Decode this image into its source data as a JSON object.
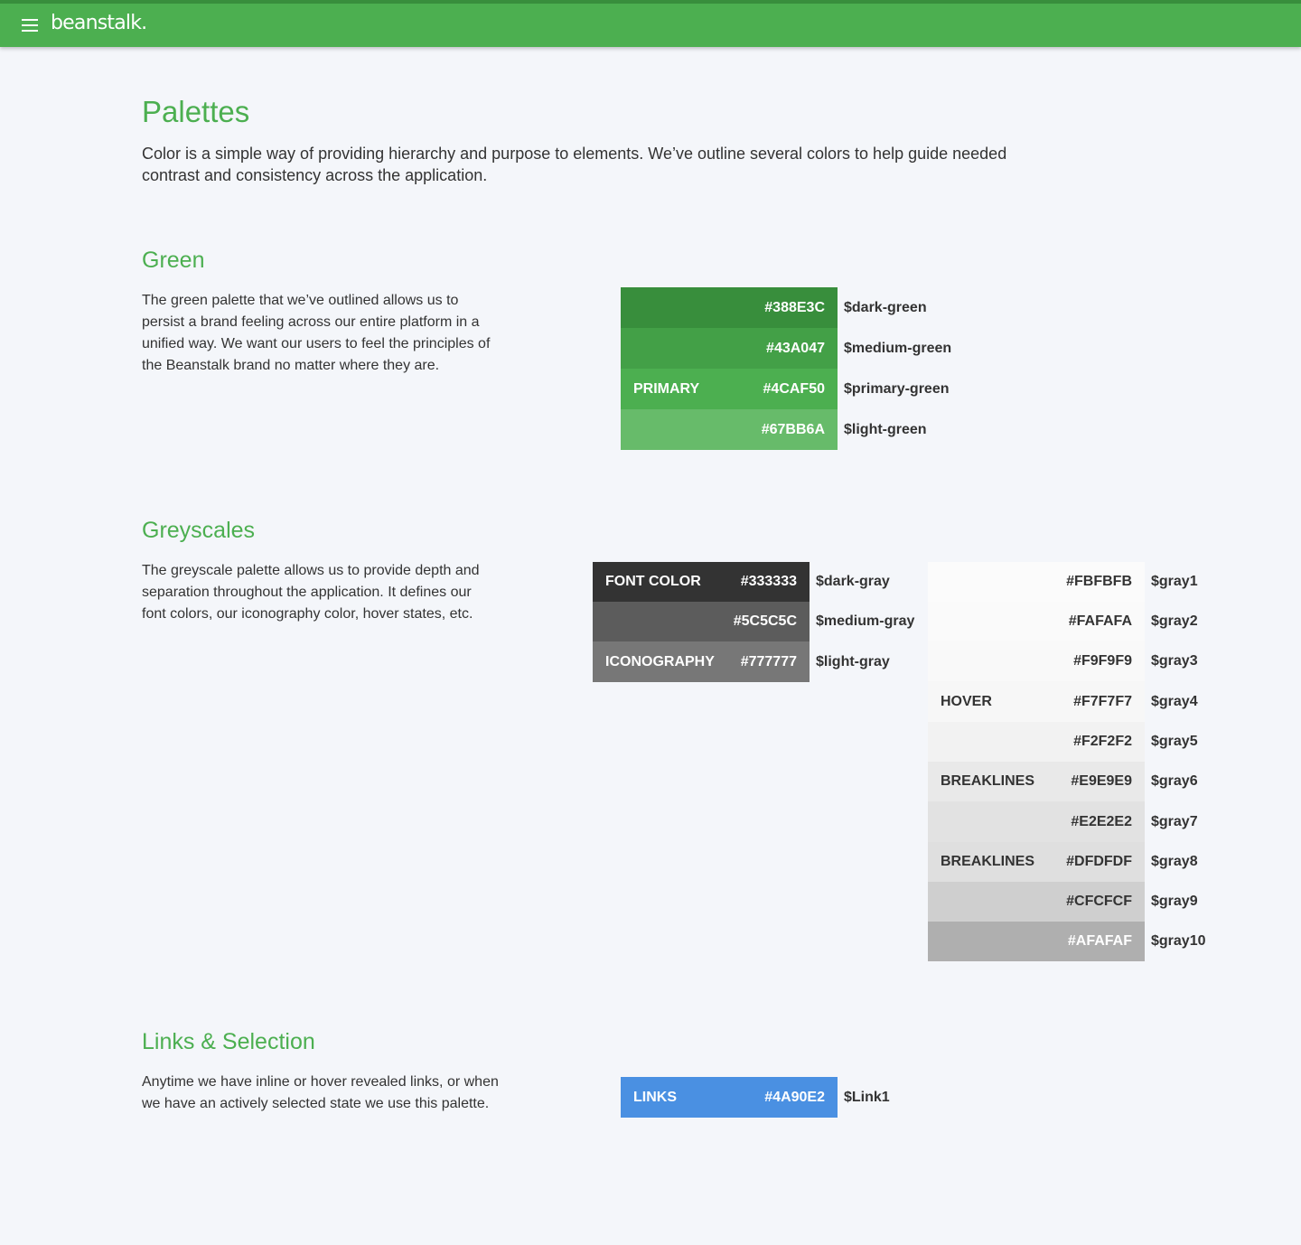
{
  "header": {
    "logo": "beanstalk."
  },
  "page": {
    "title": "Palettes",
    "intro": "Color is a simple way of providing hierarchy and purpose to elements. We’ve outline several colors to help guide needed contrast and  consistency across the application."
  },
  "green": {
    "title": "Green",
    "description": "The green palette that we’ve outlined allows us to persist a brand feeling across our entire platform in a unified way. We want our users to feel the principles of the Beanstalk brand no matter where they are.",
    "swatches": [
      {
        "label": "",
        "hex": "#388E3C",
        "var": "$dark-green",
        "color": "#388e3c"
      },
      {
        "label": "",
        "hex": "#43A047",
        "var": "$medium-green",
        "color": "#43a047"
      },
      {
        "label": "PRIMARY",
        "hex": "#4CAF50",
        "var": "$primary-green",
        "color": "#4caf50"
      },
      {
        "label": "",
        "hex": "#67BB6A",
        "var": "$light-green",
        "color": "#67bb6a"
      }
    ]
  },
  "greyscales": {
    "title": "Greyscales",
    "description": "The greyscale palette allows us to provide depth and separation throughout the application. It defines our font colors, our iconography color, hover states, etc.",
    "dark_swatches": [
      {
        "label": "FONT COLOR",
        "hex": "#333333",
        "var": "$dark-gray",
        "color": "#333333"
      },
      {
        "label": "",
        "hex": "#5C5C5C",
        "var": "$medium-gray",
        "color": "#5c5c5c"
      },
      {
        "label": "ICONOGRAPHY",
        "hex": "#777777",
        "var": "$light-gray",
        "color": "#777777"
      }
    ],
    "light_swatches": [
      {
        "label": "",
        "hex": "#FBFBFB",
        "var": "$gray1",
        "color": "#fbfbfb"
      },
      {
        "label": "",
        "hex": "#FAFAFA",
        "var": "$gray2",
        "color": "#fafafa"
      },
      {
        "label": "",
        "hex": "#F9F9F9",
        "var": "$gray3",
        "color": "#f9f9f9"
      },
      {
        "label": "HOVER",
        "hex": "#F7F7F7",
        "var": "$gray4",
        "color": "#f7f7f7"
      },
      {
        "label": "",
        "hex": "#F2F2F2",
        "var": "$gray5",
        "color": "#f2f2f2"
      },
      {
        "label": "BREAKLINES",
        "hex": "#E9E9E9",
        "var": "$gray6",
        "color": "#e9e9e9"
      },
      {
        "label": "",
        "hex": "#E2E2E2",
        "var": "$gray7",
        "color": "#e2e2e2"
      },
      {
        "label": "BREAKLINES",
        "hex": "#DFDFDF",
        "var": "$gray8",
        "color": "#dfdfdf"
      },
      {
        "label": "",
        "hex": "#CFCFCF",
        "var": "$gray9",
        "color": "#cfcfcf"
      },
      {
        "label": "",
        "hex": "#AFAFAF",
        "var": "$gray10",
        "color": "#afafaf"
      }
    ]
  },
  "links": {
    "title": "Links & Selection",
    "description": "Anytime we have inline or hover revealed links, or when we have an actively selected state we use this palette.",
    "swatches": [
      {
        "label": "LINKS",
        "hex": "#4A90E2",
        "var": "$Link1",
        "color": "#4a90e2"
      }
    ]
  }
}
